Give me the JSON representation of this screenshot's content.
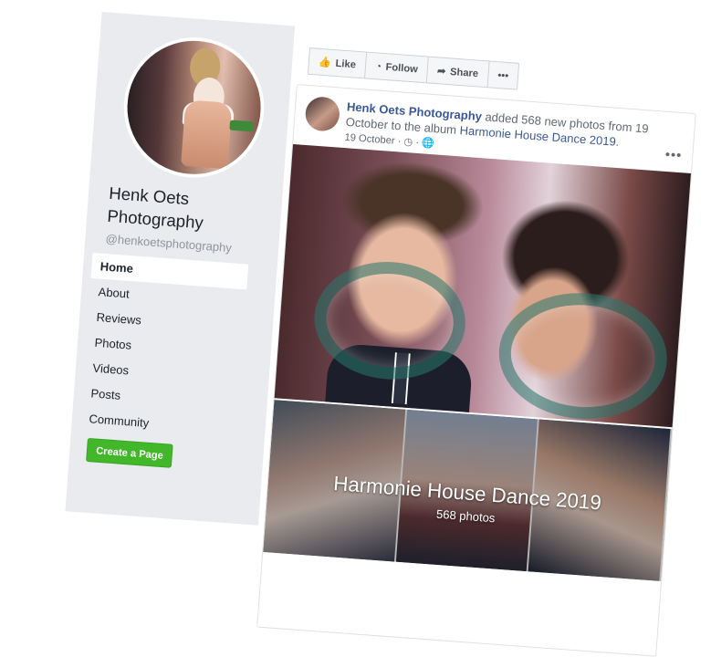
{
  "sidebar": {
    "page_name": "Henk Oets Photography",
    "handle": "@henkoetsphotography",
    "nav": [
      {
        "label": "Home",
        "active": true
      },
      {
        "label": "About"
      },
      {
        "label": "Reviews"
      },
      {
        "label": "Photos"
      },
      {
        "label": "Videos"
      },
      {
        "label": "Posts"
      },
      {
        "label": "Community"
      }
    ],
    "create_page_label": "Create a Page"
  },
  "actions": {
    "like": "Like",
    "follow": "Follow",
    "share": "Share",
    "more": "•••"
  },
  "post": {
    "author": "Henk Oets Photography",
    "action_text": " added 568 new photos from 19 October to the album ",
    "album_link": "Harmonie House Dance 2019",
    "period": ".",
    "date": "19 October",
    "meta_sep1": " · ",
    "meta_sep2": " · ",
    "more": "•••",
    "icons": [
      "clock-icon",
      "globe-icon"
    ]
  },
  "album": {
    "title": "Harmonie House Dance 2019",
    "count": "568 photos"
  },
  "colors": {
    "link": "#385898",
    "create_button": "#42b72a",
    "sidebar_bg": "#e9ebee"
  }
}
